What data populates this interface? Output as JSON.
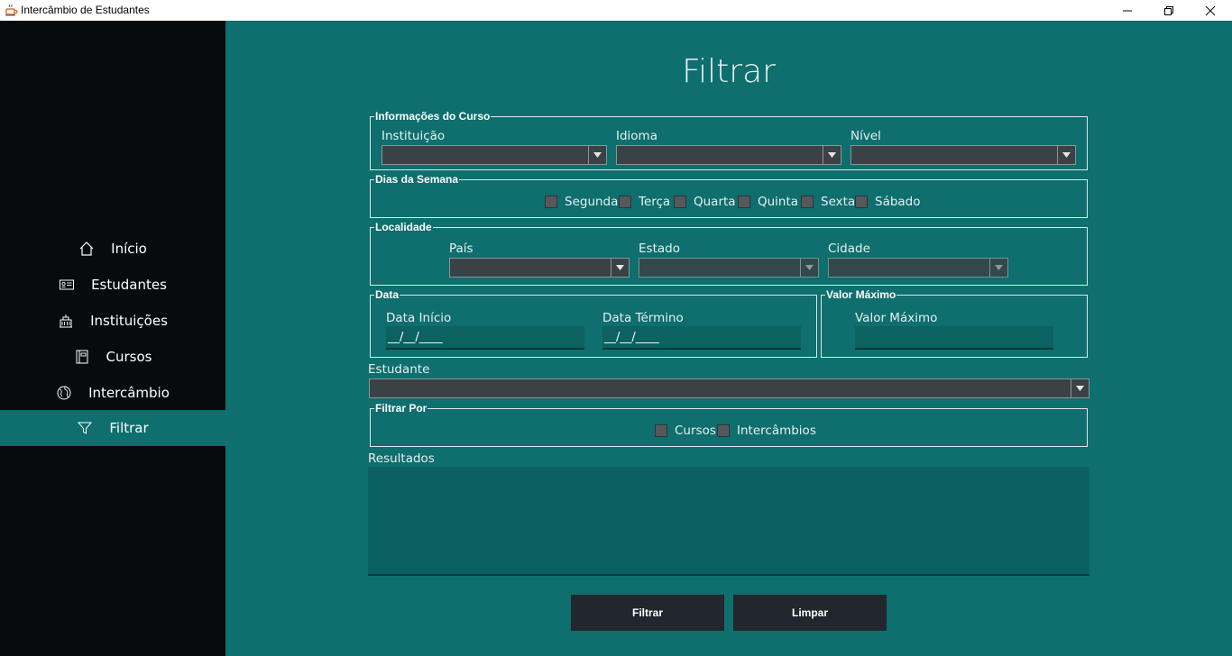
{
  "window": {
    "title": "Intercâmbio de Estudantes",
    "icons": [
      "java-icon",
      "minimize-icon",
      "restore-icon",
      "close-icon"
    ]
  },
  "sidebar": {
    "items": [
      {
        "label": "Início",
        "icon": "home-icon"
      },
      {
        "label": "Estudantes",
        "icon": "id-card-icon"
      },
      {
        "label": "Instituições",
        "icon": "building-icon"
      },
      {
        "label": "Cursos",
        "icon": "book-icon"
      },
      {
        "label": "Intercâmbio",
        "icon": "globe-icon"
      },
      {
        "label": "Filtrar",
        "icon": "filter-icon",
        "active": true
      }
    ]
  },
  "main": {
    "title": "Filtrar",
    "curso": {
      "legend": "Informações do Curso",
      "instituicao_label": "Instituição",
      "idioma_label": "Idioma",
      "nivel_label": "Nível"
    },
    "dias": {
      "legend": "Dias da Semana",
      "days": [
        "Segunda",
        "Terça",
        "Quarta",
        "Quinta",
        "Sexta",
        "Sábado"
      ]
    },
    "localidade": {
      "legend": "Localidade",
      "pais_label": "País",
      "estado_label": "Estado",
      "cidade_label": "Cidade"
    },
    "data": {
      "legend": "Data",
      "inicio_label": "Data Início",
      "inicio_value": "__/__/____",
      "termino_label": "Data Término",
      "termino_value": "__/__/____"
    },
    "valor": {
      "legend": "Valor Máximo",
      "label": "Valor Máximo",
      "value": ""
    },
    "estudante_label": "Estudante",
    "filtrar_por": {
      "legend": "Filtrar Por",
      "options": [
        "Cursos",
        "Intercâmbios"
      ]
    },
    "resultados_label": "Resultados",
    "buttons": {
      "filtrar": "Filtrar",
      "limpar": "Limpar"
    }
  },
  "colors": {
    "background": "#0f6e6e",
    "sidebar": "#070b0e",
    "button": "#21272d",
    "combo": "#3b4246"
  }
}
